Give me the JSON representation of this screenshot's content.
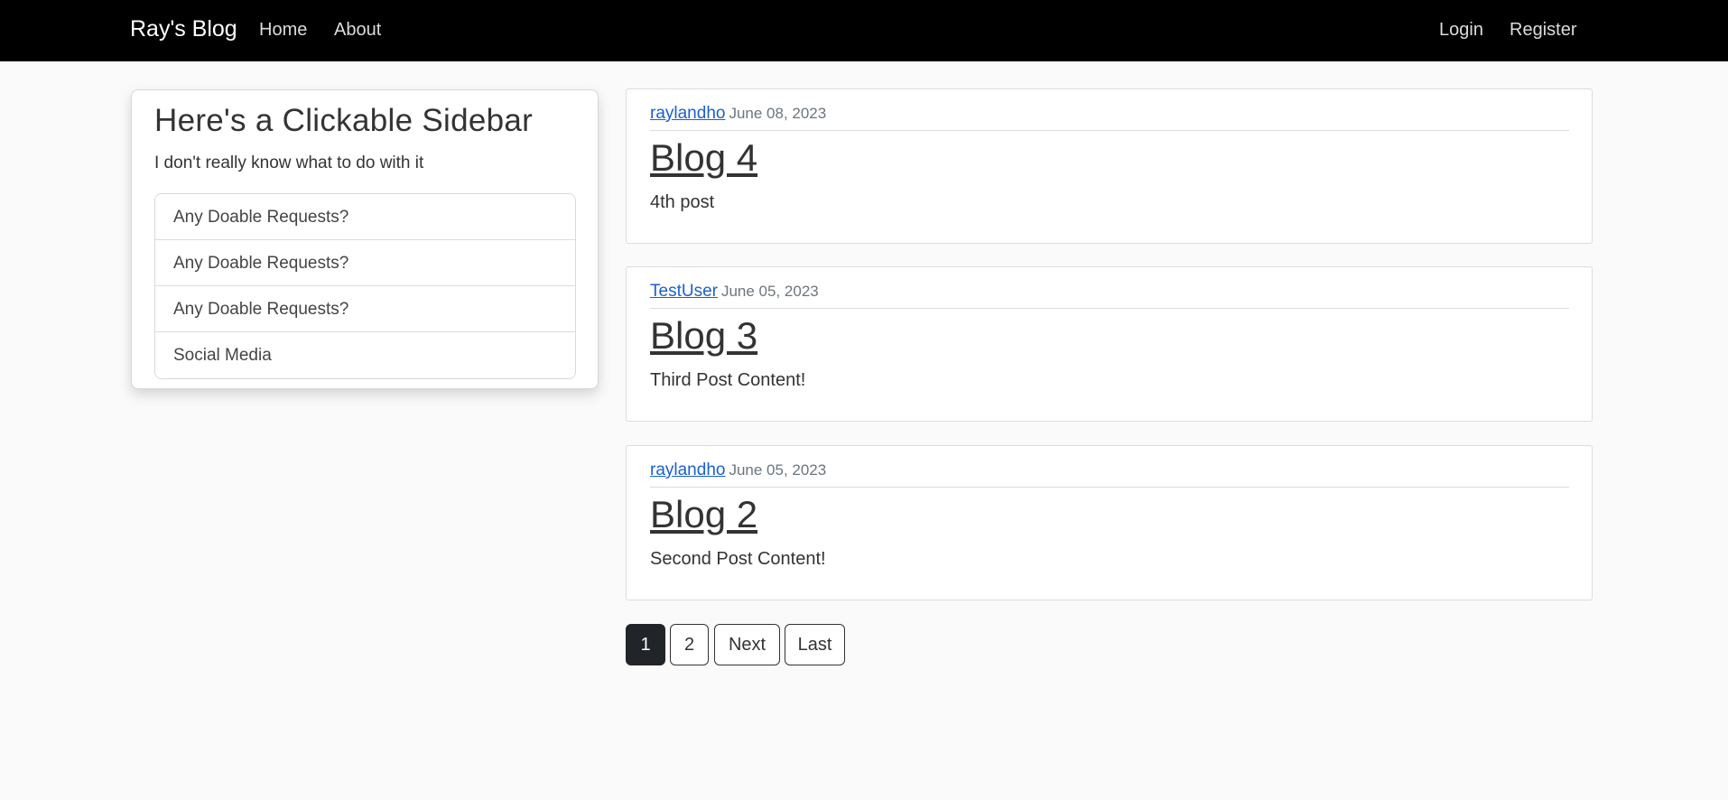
{
  "navbar": {
    "brand": "Ray's Blog",
    "links": [
      "Home",
      "About"
    ],
    "right_links": [
      "Login",
      "Register"
    ]
  },
  "sidebar": {
    "title": "Here's a Clickable Sidebar",
    "subtitle": "I don't really know what to do with it",
    "items": [
      "Any Doable Requests?",
      "Any Doable Requests?",
      "Any Doable Requests?",
      "Social Media"
    ]
  },
  "posts": [
    {
      "author": "raylandho",
      "date": "June 08, 2023",
      "title": "Blog 4",
      "content": "4th post"
    },
    {
      "author": "TestUser",
      "date": "June 05, 2023",
      "title": "Blog 3",
      "content": "Third Post Content!"
    },
    {
      "author": "raylandho",
      "date": "June 05, 2023",
      "title": "Blog 2",
      "content": "Second Post Content!"
    }
  ],
  "pagination": {
    "pages": [
      "1",
      "2"
    ],
    "next": "Next",
    "last": "Last",
    "current": "1"
  },
  "colors": {
    "navbar_bg": "#000000",
    "link": "#1a5fd1",
    "active_page": "#212529"
  }
}
